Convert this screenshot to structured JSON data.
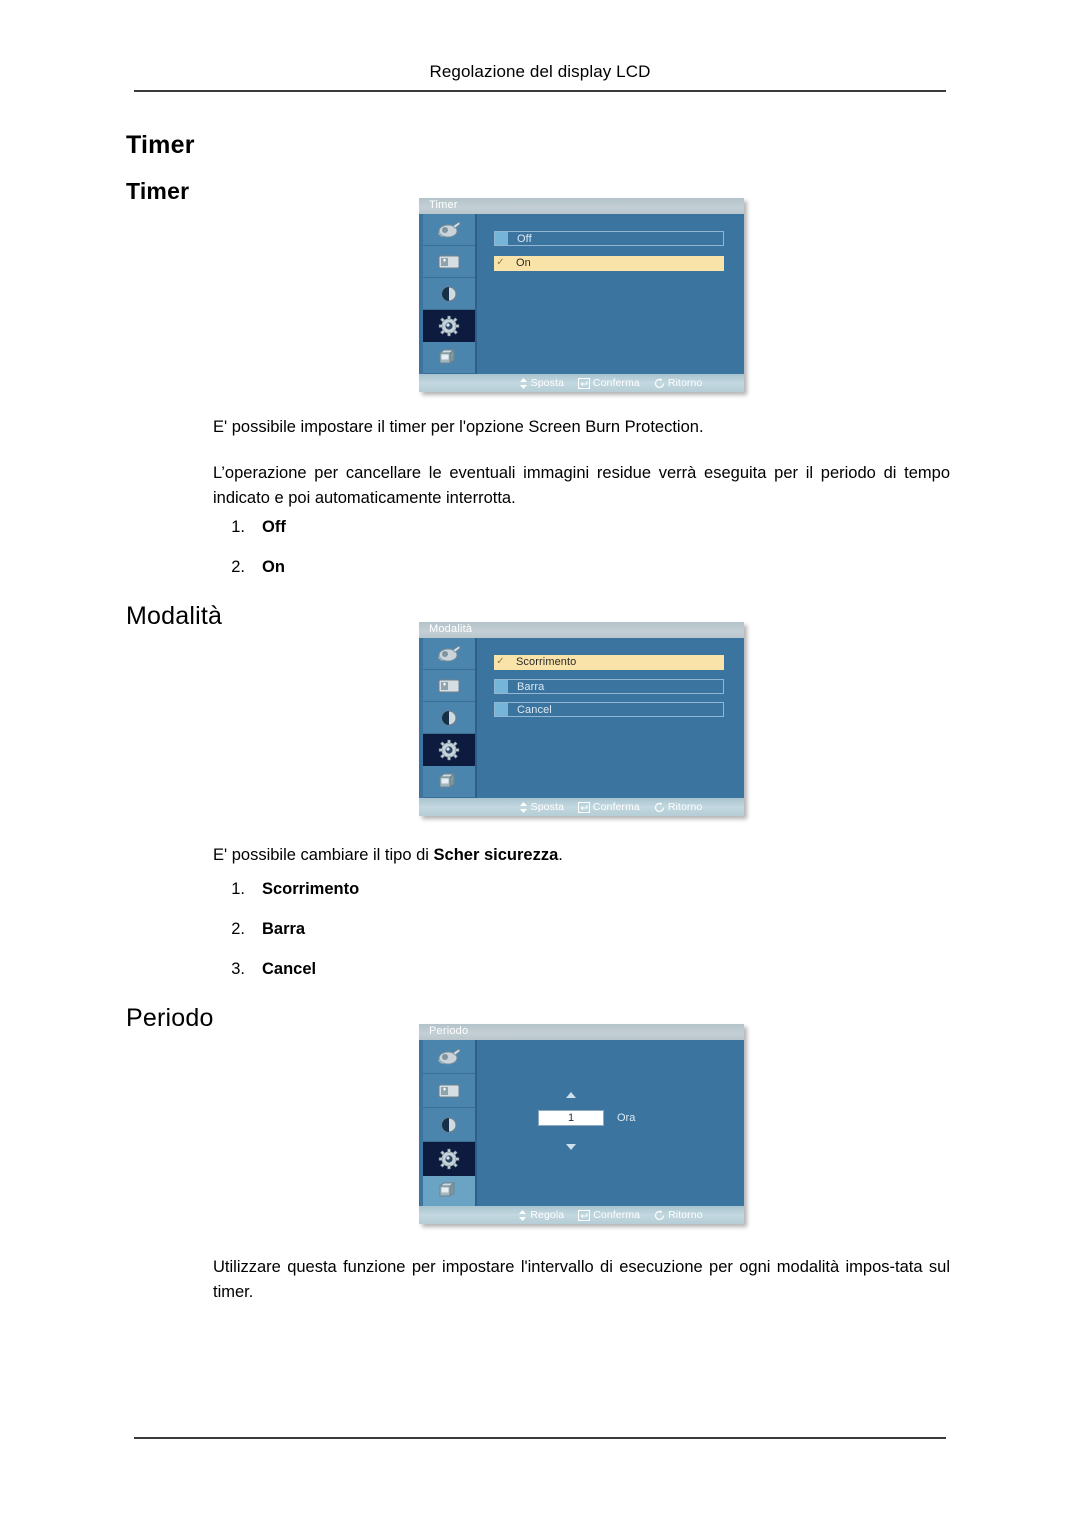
{
  "header": {
    "running_title": "Regolazione del display LCD"
  },
  "sections": [
    {
      "heading": "Timer",
      "subheading": "Timer",
      "osd": {
        "title": "Timer",
        "options": [
          {
            "label": "Off",
            "selected": false
          },
          {
            "label": "On",
            "selected": true
          }
        ],
        "footer": [
          {
            "icon": "up-down-arrow-icon",
            "label": "Sposta"
          },
          {
            "icon": "enter-key-icon",
            "label": "Conferma"
          },
          {
            "icon": "return-arrow-icon",
            "label": "Ritorno"
          }
        ],
        "sidebar_icons": [
          "picture-icon",
          "screen-icon",
          "contrast-icon",
          "setup-gear-icon",
          "multi-control-icon"
        ],
        "selected_sidebar_index": 3
      },
      "paragraphs": [
        "E' possibile impostare il timer per l'opzione Screen Burn Protection.",
        "L’operazione per cancellare le eventuali immagini residue verrà eseguita per il periodo di tempo indicato e poi automaticamente interrotta."
      ],
      "list": [
        {
          "num": "1.",
          "label": "Off"
        },
        {
          "num": "2.",
          "label": "On"
        }
      ]
    },
    {
      "heading": "Modalità",
      "osd": {
        "title": "Modalità",
        "options": [
          {
            "label": "Scorrimento",
            "selected": true
          },
          {
            "label": "Barra",
            "selected": false
          },
          {
            "label": "Cancel",
            "selected": false
          }
        ],
        "footer": [
          {
            "icon": "up-down-arrow-icon",
            "label": "Sposta"
          },
          {
            "icon": "enter-key-icon",
            "label": "Conferma"
          },
          {
            "icon": "return-arrow-icon",
            "label": "Ritorno"
          }
        ],
        "selected_sidebar_index": 3
      },
      "intro_prefix": "E' possibile cambiare il tipo di ",
      "intro_bold": "Scher sicurezza",
      "intro_suffix": ".",
      "list": [
        {
          "num": "1.",
          "label": "Scorrimento"
        },
        {
          "num": "2.",
          "label": "Barra"
        },
        {
          "num": "3.",
          "label": "Cancel"
        }
      ]
    },
    {
      "heading": "Periodo",
      "osd": {
        "title": "Periodo",
        "spinner": {
          "value": "1",
          "unit": "Ora"
        },
        "footer": [
          {
            "icon": "up-down-arrow-icon",
            "label": "Regola"
          },
          {
            "icon": "enter-key-icon",
            "label": "Conferma"
          },
          {
            "icon": "return-arrow-icon",
            "label": "Ritorno"
          }
        ],
        "selected_sidebar_index": 3,
        "highlight_sidebar_index": 4
      },
      "paragraph": "Utilizzare questa funzione per impostare l'intervallo di esecuzione per ogni modalità impos-tata sul timer."
    }
  ],
  "colors": {
    "osd_background": "#3c74a0",
    "osd_titlebar": "#b9c6cc",
    "osd_selected_row": "#fae3a9",
    "osd_sidebar_item": "#4b85ad",
    "osd_sidebar_selected": "#0d1b3e",
    "osd_footer_bar": "#bcd4dd",
    "rule": "#3b3b3b"
  }
}
